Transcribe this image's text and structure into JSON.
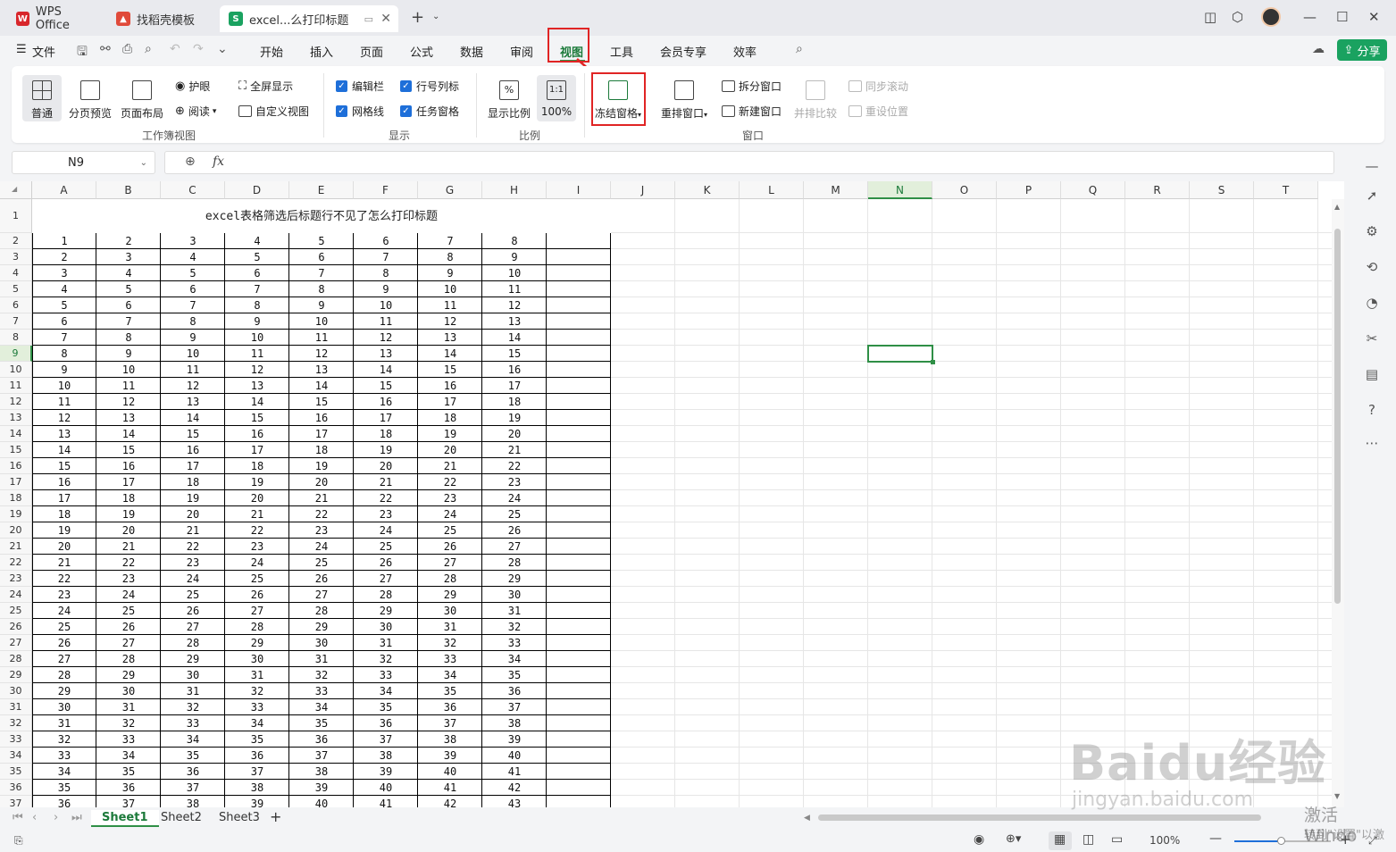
{
  "titlebar": {
    "tabs": [
      {
        "label": "WPS Office",
        "icon": "wps-logo-icon"
      },
      {
        "label": "找稻壳模板",
        "icon": "docer-icon"
      },
      {
        "label": "excel...么打印标题",
        "icon": "spreadsheet-s-icon",
        "icon_letter": "S"
      }
    ],
    "new_tab": "+"
  },
  "menu": {
    "file": "文件",
    "items": [
      "开始",
      "插入",
      "页面",
      "公式",
      "数据",
      "审阅",
      "视图",
      "工具",
      "会员专享",
      "效率"
    ],
    "active": "视图",
    "share": "分享"
  },
  "ribbon": {
    "workbook_views": {
      "normal": "普通",
      "page_break": "分页预览",
      "page_layout": "页面布局",
      "eye_protect": "护眼",
      "reading": "阅读",
      "fullscreen": "全屏显示",
      "custom_view": "自定义视图",
      "group": "工作簿视图"
    },
    "show": {
      "formula_bar": "编辑栏",
      "headings": "行号列标",
      "gridlines": "网格线",
      "task_pane": "任务窗格",
      "group": "显示"
    },
    "zoom": {
      "zoom_ratio": "显示比例",
      "hundred": "100%",
      "one_to_one": "1:1",
      "group": "比例"
    },
    "window": {
      "freeze": "冻结窗格",
      "arrange": "重排窗口",
      "split": "拆分窗口",
      "new_window": "新建窗口",
      "side_by_side": "并排比较",
      "sync_scroll": "同步滚动",
      "reset_position": "重设位置",
      "group": "窗口"
    }
  },
  "formula_bar": {
    "name_box": "N9",
    "fx": "fx"
  },
  "sheet": {
    "columns": [
      "A",
      "B",
      "C",
      "D",
      "E",
      "F",
      "G",
      "H",
      "I",
      "J",
      "K",
      "L",
      "M",
      "N",
      "O",
      "P",
      "Q",
      "R",
      "S",
      "T"
    ],
    "selected_column": "N",
    "selected_row": 9,
    "title": "excel表格筛选后标题行不见了怎么打印标题",
    "row_numbers": [
      "1",
      "2",
      "3",
      "4",
      "5",
      "6",
      "7",
      "8",
      "9",
      "10",
      "11",
      "12",
      "13",
      "14",
      "15",
      "16",
      "17",
      "18",
      "19",
      "20",
      "21",
      "22",
      "23",
      "24",
      "25",
      "26",
      "27",
      "28",
      "29",
      "30",
      "31",
      "32",
      "33",
      "34",
      "35",
      "36",
      "37"
    ],
    "data_rows": [
      [
        1,
        2,
        3,
        4,
        5,
        6,
        7,
        8
      ],
      [
        2,
        3,
        4,
        5,
        6,
        7,
        8,
        9
      ],
      [
        3,
        4,
        5,
        6,
        7,
        8,
        9,
        10
      ],
      [
        4,
        5,
        6,
        7,
        8,
        9,
        10,
        11
      ],
      [
        5,
        6,
        7,
        8,
        9,
        10,
        11,
        12
      ],
      [
        6,
        7,
        8,
        9,
        10,
        11,
        12,
        13
      ],
      [
        7,
        8,
        9,
        10,
        11,
        12,
        13,
        14
      ],
      [
        8,
        9,
        10,
        11,
        12,
        13,
        14,
        15
      ],
      [
        9,
        10,
        11,
        12,
        13,
        14,
        15,
        16
      ],
      [
        10,
        11,
        12,
        13,
        14,
        15,
        16,
        17
      ],
      [
        11,
        12,
        13,
        14,
        15,
        16,
        17,
        18
      ],
      [
        12,
        13,
        14,
        15,
        16,
        17,
        18,
        19
      ],
      [
        13,
        14,
        15,
        16,
        17,
        18,
        19,
        20
      ],
      [
        14,
        15,
        16,
        17,
        18,
        19,
        20,
        21
      ],
      [
        15,
        16,
        17,
        18,
        19,
        20,
        21,
        22
      ],
      [
        16,
        17,
        18,
        19,
        20,
        21,
        22,
        23
      ],
      [
        17,
        18,
        19,
        20,
        21,
        22,
        23,
        24
      ],
      [
        18,
        19,
        20,
        21,
        22,
        23,
        24,
        25
      ],
      [
        19,
        20,
        21,
        22,
        23,
        24,
        25,
        26
      ],
      [
        20,
        21,
        22,
        23,
        24,
        25,
        26,
        27
      ],
      [
        21,
        22,
        23,
        24,
        25,
        26,
        27,
        28
      ],
      [
        22,
        23,
        24,
        25,
        26,
        27,
        28,
        29
      ],
      [
        23,
        24,
        25,
        26,
        27,
        28,
        29,
        30
      ],
      [
        24,
        25,
        26,
        27,
        28,
        29,
        30,
        31
      ],
      [
        25,
        26,
        27,
        28,
        29,
        30,
        31,
        32
      ],
      [
        26,
        27,
        28,
        29,
        30,
        31,
        32,
        33
      ],
      [
        27,
        28,
        29,
        30,
        31,
        32,
        33,
        34
      ],
      [
        28,
        29,
        30,
        31,
        32,
        33,
        34,
        35
      ],
      [
        29,
        30,
        31,
        32,
        33,
        34,
        35,
        36
      ],
      [
        30,
        31,
        32,
        33,
        34,
        35,
        36,
        37
      ],
      [
        31,
        32,
        33,
        34,
        35,
        36,
        37,
        38
      ],
      [
        32,
        33,
        34,
        35,
        36,
        37,
        38,
        39
      ],
      [
        33,
        34,
        35,
        36,
        37,
        38,
        39,
        40
      ],
      [
        34,
        35,
        36,
        37,
        38,
        39,
        40,
        41
      ],
      [
        35,
        36,
        37,
        38,
        39,
        40,
        41,
        42
      ],
      [
        36,
        37,
        38,
        39,
        40,
        41,
        42,
        43
      ]
    ]
  },
  "sheet_tabs": [
    "Sheet1",
    "Sheet2",
    "Sheet3"
  ],
  "active_sheet": "Sheet1",
  "status": {
    "zoom": "100%"
  },
  "watermark": {
    "brand": "Baidu经验",
    "url": "jingyan.baidu.com",
    "activation": "激活 Windo",
    "activation_sub": "转到\"设置\"以激"
  },
  "colors": {
    "accent_green": "#2f8f46",
    "share_green": "#1aa260",
    "highlight_red": "#e02424",
    "checkbox_blue": "#1e6fd9"
  }
}
